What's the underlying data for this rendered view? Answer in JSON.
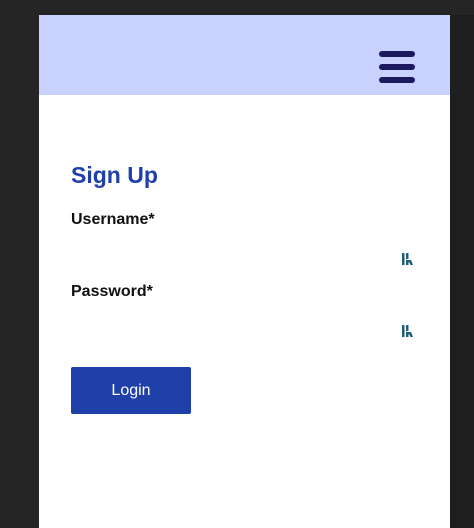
{
  "header": {
    "menu_icon": "hamburger-menu-icon",
    "background": "#c9d1ff",
    "icon_color": "#1b1a5e"
  },
  "form": {
    "title": "Sign Up",
    "username_label": "Username*",
    "username_value": "",
    "password_label": "Password*",
    "password_value": "",
    "field_icon": "password-manager-icon",
    "submit_label": "Login"
  },
  "colors": {
    "accent": "#1f3fa9",
    "frame_bg": "#ffffff",
    "outer_bg": "#252526"
  }
}
